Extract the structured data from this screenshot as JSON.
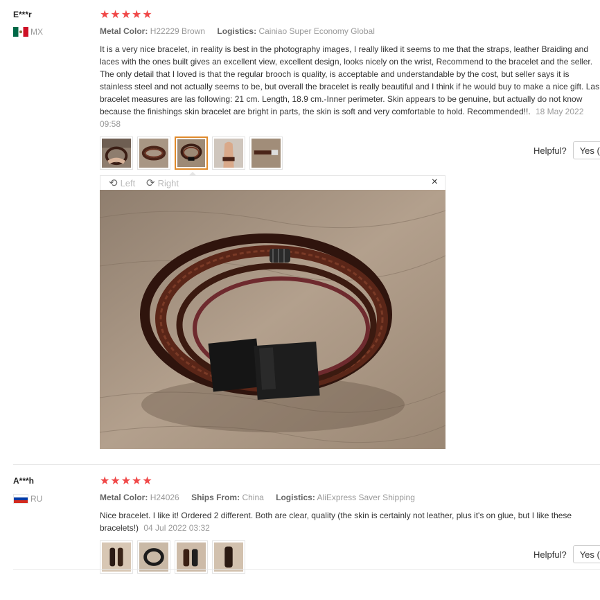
{
  "reviews": [
    {
      "user": "E***r",
      "country": "MX",
      "rating_label": "★★★★★",
      "attrs": {
        "metal_label": "Metal Color:",
        "metal_value": "H22229 Brown",
        "logistics_label": "Logistics:",
        "logistics_value": "Cainiao Super Economy Global"
      },
      "text": "It is a very nice bracelet, in reality is best in the photography images, I really liked it seems to me that the straps, leather Braiding and laces with the ones built gives an excellent view, excellent design, looks nicely on the wrist, Recommend to the bracelet and the seller. The only detail that I loved is that the regular brooch is quality, is acceptable and understandable by the cost, but seller says it is stainless steel and not actually seems to be, but overall the bracelet is really beautiful and I think if he would buy to make a nice gift. Las bracelet measures are las following: 21 cm. Length, 18.9 cm.-Inner perimeter. Skin appears to be genuine, but actually do not know because the finishings skin bracelet are bright in parts, the skin is soft and very comfortable to hold. Recommended!!.",
      "date": "18 May 2022 09:58",
      "helpful_label": "Helpful?",
      "yes_label": "Yes ("
    },
    {
      "user": "A***h",
      "country": "RU",
      "rating_label": "★★★★★",
      "attrs": {
        "metal_label": "Metal Color:",
        "metal_value": "H24026",
        "ships_label": "Ships From:",
        "ships_value": "China",
        "logistics_label": "Logistics:",
        "logistics_value": "AliExpress Saver Shipping"
      },
      "text": "Nice bracelet. I like it! Ordered 2 different. Both are clear, quality (the skin is certainly not leather, plus it's on glue, but I like these bracelets!)",
      "date": "04 Jul 2022 03:32",
      "helpful_label": "Helpful?",
      "yes_label": "Yes ("
    }
  ],
  "viewer": {
    "left_label": "Left",
    "right_label": "Right",
    "close_glyph": "×",
    "rotate_left_glyph": "⟲",
    "rotate_right_glyph": "⟳"
  },
  "colors": {
    "star": "#f04848",
    "active_thumb_border": "#e08a2b",
    "leather_brown": "#4a2418",
    "wood": "#a58f7a"
  }
}
